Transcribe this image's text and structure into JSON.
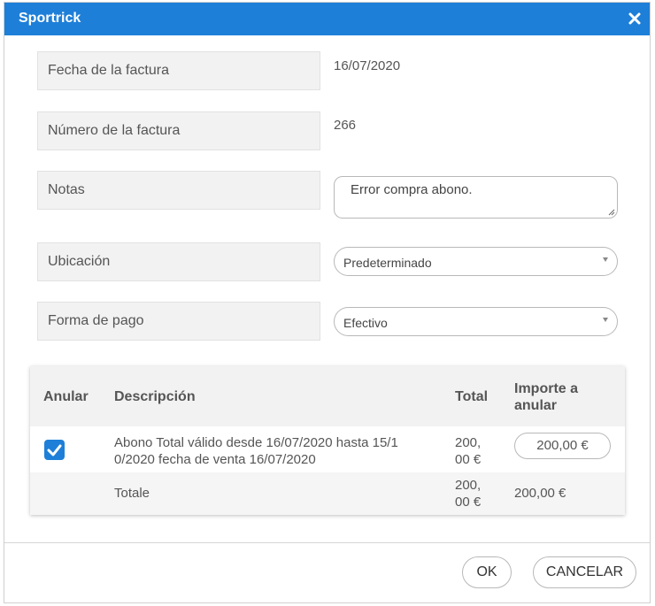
{
  "window": {
    "title": "Sportrick"
  },
  "form": {
    "fecha_label": "Fecha de la factura",
    "fecha_value": "16/07/2020",
    "numero_label": "Número de la factura",
    "numero_value": "266",
    "notas_label": "Notas",
    "notas_value": "Error compra abono.",
    "ubicacion_label": "Ubicación",
    "ubicacion_value": "Predeterminado",
    "forma_pago_label": "Forma de pago",
    "forma_pago_value": "Efectivo"
  },
  "table": {
    "headers": {
      "anular": "Anular",
      "descripcion": "Descripción",
      "total": "Total",
      "importe_1": "Importe a",
      "importe_2": "anular"
    },
    "row": {
      "checked": true,
      "desc_line1": "Abono Total válido desde 16/07/2020 hasta 15/1",
      "desc_line2": "0/2020 fecha de venta 16/07/2020",
      "total_line1": "200,",
      "total_line2": "00 €",
      "importe": "200,00 €"
    },
    "totals": {
      "label": "Totale",
      "total_line1": "200,",
      "total_line2": "00 €",
      "importe": "200,00 €"
    }
  },
  "buttons": {
    "ok": "OK",
    "cancel": "CANCELAR"
  },
  "colors": {
    "accent": "#1e7fd8"
  }
}
